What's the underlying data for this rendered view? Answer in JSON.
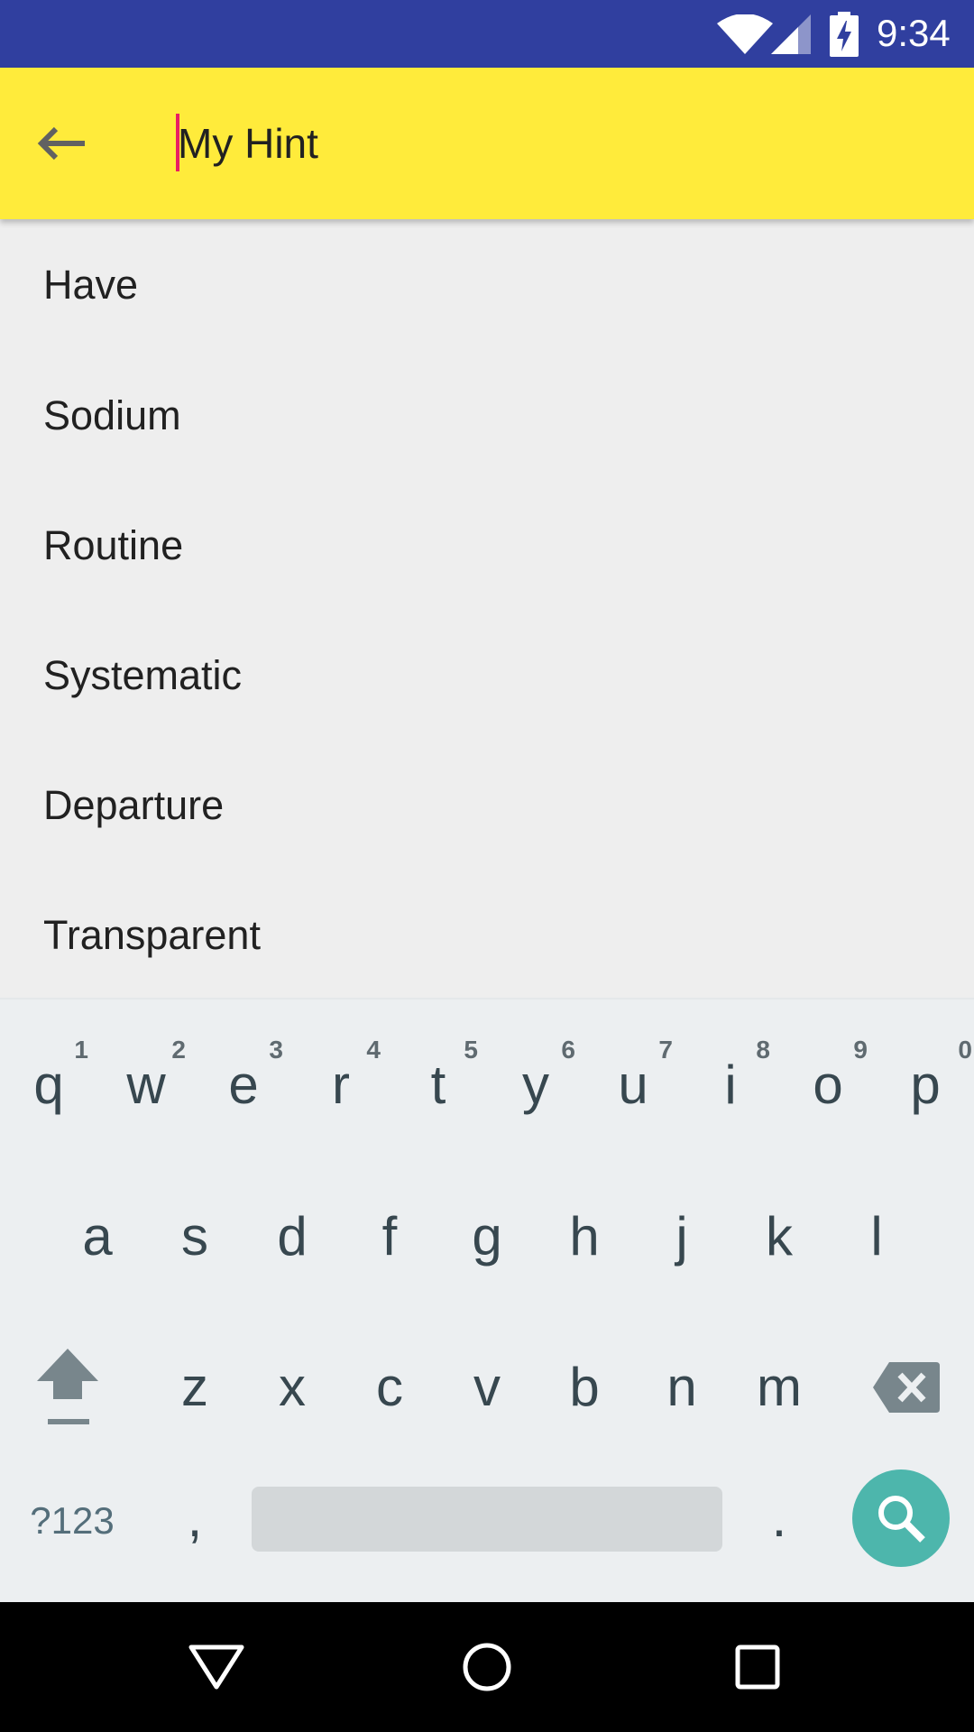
{
  "status_bar": {
    "time": "9:34",
    "icons": [
      "wifi-icon",
      "signal-icon",
      "battery-charging-icon"
    ]
  },
  "toolbar": {
    "background": "#ffeb3b",
    "back_icon": "arrow-back-icon",
    "search": {
      "placeholder": "My Hint",
      "value": ""
    },
    "cursor_color": "#e91e63"
  },
  "suggestions": [
    {
      "label": "Have"
    },
    {
      "label": "Sodium"
    },
    {
      "label": "Routine"
    },
    {
      "label": "Systematic"
    },
    {
      "label": "Departure"
    },
    {
      "label": "Transparent"
    }
  ],
  "keyboard": {
    "row1": [
      {
        "key": "q",
        "hint": "1"
      },
      {
        "key": "w",
        "hint": "2"
      },
      {
        "key": "e",
        "hint": "3"
      },
      {
        "key": "r",
        "hint": "4"
      },
      {
        "key": "t",
        "hint": "5"
      },
      {
        "key": "y",
        "hint": "6"
      },
      {
        "key": "u",
        "hint": "7"
      },
      {
        "key": "i",
        "hint": "8"
      },
      {
        "key": "o",
        "hint": "9"
      },
      {
        "key": "p",
        "hint": "0"
      }
    ],
    "row2": [
      "a",
      "s",
      "d",
      "f",
      "g",
      "h",
      "j",
      "k",
      "l"
    ],
    "row3": [
      "z",
      "x",
      "c",
      "v",
      "b",
      "n",
      "m"
    ],
    "shift_icon": "shift-icon",
    "backspace_icon": "backspace-icon",
    "symbols_label": "?123",
    "comma": ",",
    "period": ".",
    "search_icon": "search-icon",
    "search_key_color": "#4db6ac"
  },
  "nav_bar": {
    "back_icon": "nav-back-icon",
    "home_icon": "nav-home-icon",
    "recents_icon": "nav-recents-icon"
  },
  "colors": {
    "status_bar": "#303f9f",
    "content_bg": "#eeeeee",
    "keyboard_bg": "#eceff1",
    "key_text": "#37474f"
  }
}
